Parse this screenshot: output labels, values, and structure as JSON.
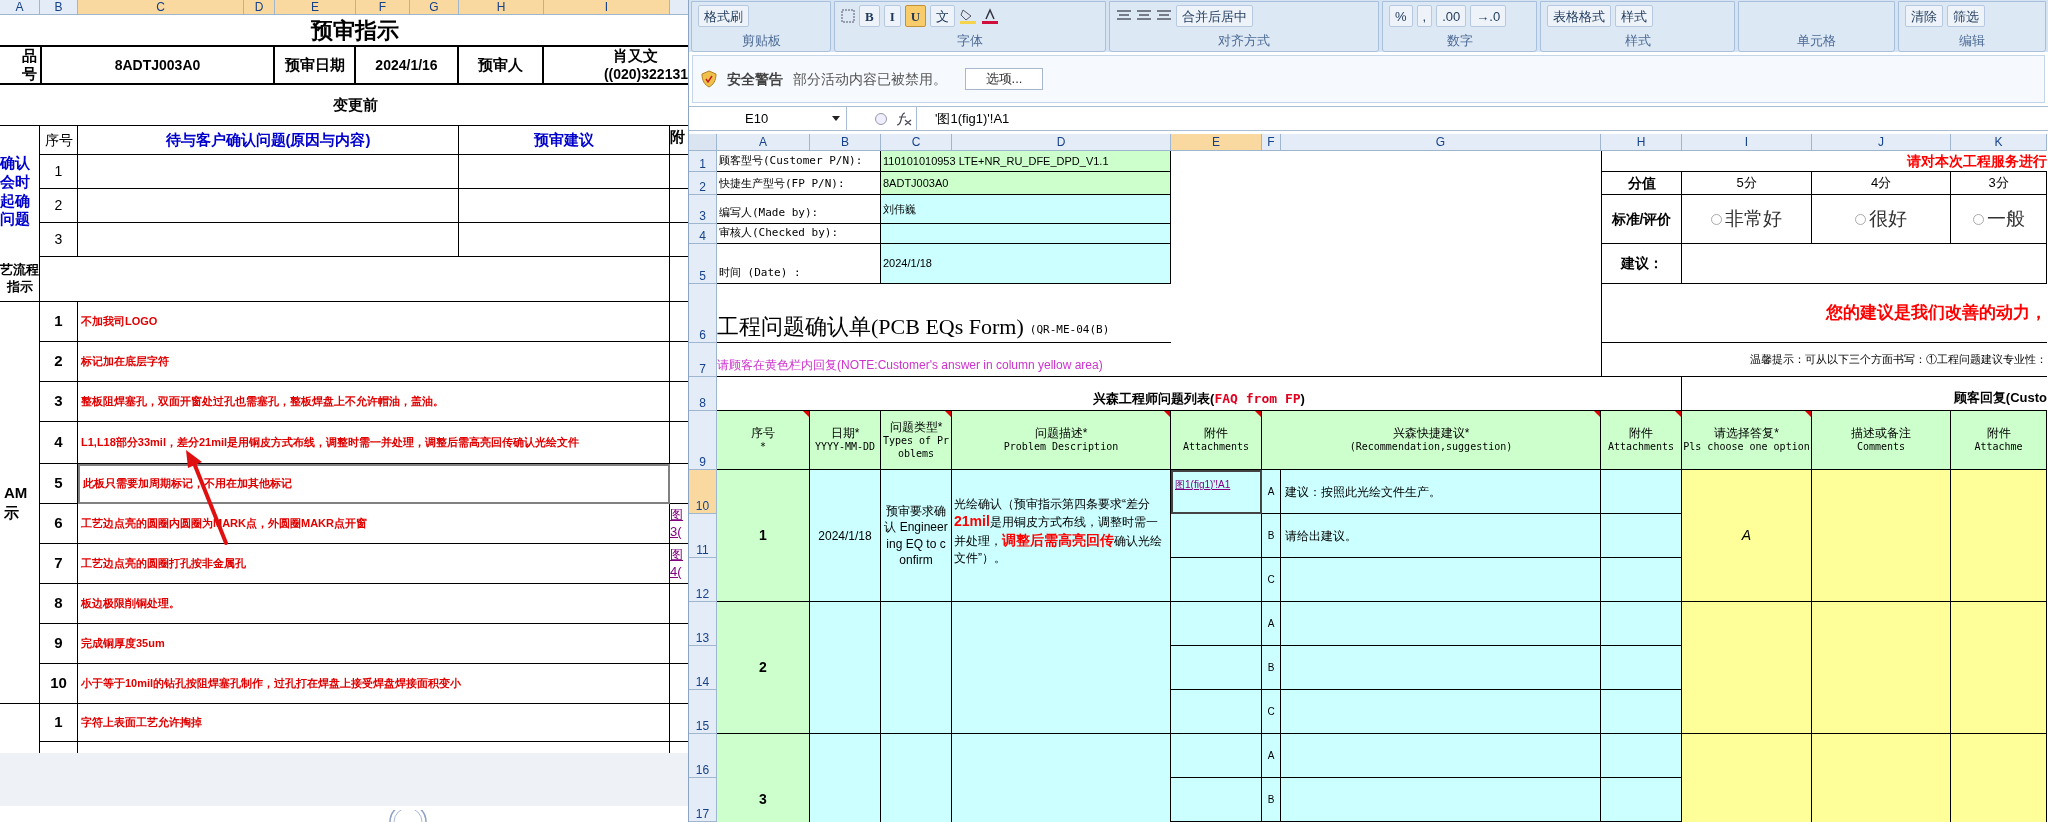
{
  "left_sheet": {
    "columns": [
      {
        "label": "A",
        "selected": false
      },
      {
        "label": "B",
        "selected": false
      },
      {
        "label": "C",
        "selected": true
      },
      {
        "label": "D",
        "selected": true
      },
      {
        "label": "E",
        "selected": true
      },
      {
        "label": "F",
        "selected": true
      },
      {
        "label": "G",
        "selected": true
      },
      {
        "label": "H",
        "selected": true
      },
      {
        "label": "I",
        "selected": true
      }
    ],
    "title": "预审指示",
    "product_label": "品号",
    "part_no": "8ADTJ003A0",
    "date_label": "预审日期",
    "date": "2024/1/16",
    "reviewer_label": "预审人",
    "reviewer": "肖又文",
    "phone": "((020)322131",
    "section": "变更前",
    "confirm": {
      "side_label": "确认会时起确问题",
      "no_header": "序号",
      "issue_header": "待与客户确认问题(原因与内容)",
      "advice_header": "预审建议",
      "attach_header": "附",
      "rows": [
        "1",
        "2",
        "3"
      ]
    },
    "process_label": [
      "艺流程",
      "指示"
    ],
    "cam_label": [
      "AM",
      "示"
    ],
    "cam_items": [
      {
        "no": "1",
        "text": "不加我司LOGO",
        "selected": false
      },
      {
        "no": "2",
        "text": "标记加在底层字符",
        "selected": false
      },
      {
        "no": "3",
        "text": "整板阻焊塞孔，双面开窗处过孔也需塞孔，整板焊盘上不允许帽油，盖油。",
        "selected": false
      },
      {
        "no": "4",
        "text": "L1,L18部分33mil，差分21mil是用铜皮方式布线，调整时需一并处理，调整后需高亮回传确认光绘文件",
        "selected": false
      },
      {
        "no": "5",
        "text": "此板只需要加周期标记，不用在加其他标记",
        "selected": true
      },
      {
        "no": "6",
        "text": "工艺边点亮的圆圈内圆圈为MARK点，外圆圈MAKR点开窗",
        "selected": false,
        "attachment": "图3("
      },
      {
        "no": "7",
        "text": "工艺边点亮的圆圈打孔按非金属孔",
        "selected": false,
        "attachment": "图4("
      },
      {
        "no": "8",
        "text": "板边极限削铜处理。",
        "selected": false
      },
      {
        "no": "9",
        "text": "完成铜厚度35um",
        "selected": false
      },
      {
        "no": "10",
        "text": "小于等于10mil的钻孔按阻焊塞孔制作，过孔打在焊盘上接受焊盘焊接面积变小",
        "selected": false
      }
    ],
    "next_items": [
      {
        "no": "1",
        "text": "字符上表面工艺允许掏掉",
        "selected": false
      }
    ]
  },
  "excel": {
    "ribbon": [
      {
        "label": "剪贴板",
        "controls": [
          {
            "label": "格式刷",
            "selected": false
          }
        ]
      },
      {
        "label": "字体",
        "controls": [
          {
            "label": "B",
            "selected": false
          },
          {
            "label": "I",
            "selected": false
          },
          {
            "label": "U",
            "selected": true
          },
          {
            "label": "文",
            "selected": false
          }
        ]
      },
      {
        "label": "对齐方式",
        "controls": [
          {
            "label": "合并后居中",
            "selected": false
          }
        ]
      },
      {
        "label": "数字",
        "controls": [
          {
            "label": "%",
            "selected": false
          },
          {
            "label": ",",
            "selected": false
          },
          {
            "label": ".00",
            "selected": false
          },
          {
            "label": "→.0",
            "selected": false
          }
        ]
      },
      {
        "label": "样式",
        "controls": [
          {
            "label": "表格格式",
            "selected": false
          },
          {
            "label": "样式",
            "selected": false
          }
        ]
      },
      {
        "label": "单元格"
      },
      {
        "label": "编辑",
        "controls": [
          {
            "label": "清除",
            "selected": false
          },
          {
            "label": "筛选",
            "selected": false
          }
        ]
      }
    ],
    "security": {
      "title": "安全警告",
      "message": "部分活动内容已被禁用。",
      "button": "选项..."
    },
    "formula_bar": {
      "name_box": "E10",
      "formula": "'图1(fig1)'!A1"
    },
    "columns": [
      {
        "label": "A",
        "selected": false
      },
      {
        "label": "B",
        "selected": false
      },
      {
        "label": "C",
        "selected": false
      },
      {
        "label": "D",
        "selected": false
      },
      {
        "label": "E",
        "selected": true
      },
      {
        "label": "F",
        "selected": false
      },
      {
        "label": "G",
        "selected": false
      },
      {
        "label": "H",
        "selected": false
      },
      {
        "label": "I",
        "selected": false
      },
      {
        "label": "J",
        "selected": false
      },
      {
        "label": "K",
        "selected": false
      }
    ],
    "rows": [
      {
        "label": "1",
        "selected": false
      },
      {
        "label": "2",
        "selected": false
      },
      {
        "label": "3",
        "selected": false
      },
      {
        "label": "4",
        "selected": false
      },
      {
        "label": "5",
        "selected": false
      },
      {
        "label": "6",
        "selected": false
      },
      {
        "label": "7",
        "selected": false
      },
      {
        "label": "8",
        "selected": false
      },
      {
        "label": "9",
        "selected": false
      },
      {
        "label": "10",
        "selected": true
      },
      {
        "label": "11",
        "selected": false
      },
      {
        "label": "12",
        "selected": false
      },
      {
        "label": "13",
        "selected": false
      },
      {
        "label": "14",
        "selected": false
      },
      {
        "label": "15",
        "selected": false
      },
      {
        "label": "16",
        "selected": false
      },
      {
        "label": "17",
        "selected": false
      }
    ],
    "info": [
      {
        "label": "顾客型号(Customer P/N):",
        "value": "110101010953 LTE+NR_RU_DFE_DPD_V1.1"
      },
      {
        "label": "快捷生产型号(FP P/N):",
        "value": "8ADTJ003A0"
      },
      {
        "label": "编写人(Made by):",
        "value": "刘伟巍"
      },
      {
        "label": "审核人(Checked by):"
      },
      {
        "label": "时间 (Date) :",
        "value": "2024/1/18"
      }
    ],
    "form_title": "工程问题确认单(PCB EQs Form)",
    "form_code": "(QR-ME-04(B)",
    "note": "请顾客在黄色栏内回复(NOTE:Customer's answer in column yellow area)",
    "rating": {
      "prompt": "请对本次工程服务进行",
      "score_label": "分值",
      "scores": [
        "5分",
        "4分",
        "3分"
      ],
      "criteria_label": "标准/评价",
      "options": [
        {
          "label": "非常好",
          "selected": false
        },
        {
          "label": "很好",
          "selected": false
        },
        {
          "label": "一般",
          "selected": false
        }
      ],
      "suggest_label": "建议：",
      "motto": "您的建议是我们改善的动力，",
      "tip": "温馨提示：可从以下三个方面书写：①工程问题建议专业性："
    },
    "faq_title": "兴森工程师问题列表(**FAQ from FP**)",
    "reply_title": "顾客回复(Custo",
    "headers": [
      {
        "cn": "序号",
        "en": "*",
        "comment": true
      },
      {
        "cn": "日期*",
        "en": "YYYY-MM-DD",
        "comment": false
      },
      {
        "cn": "问题类型*",
        "en": "Types of Problems",
        "comment": true
      },
      {
        "cn": "问题描述*",
        "en": "Problem Description",
        "comment": true
      },
      {
        "cn": "附件",
        "en": "Attachments",
        "comment": true
      },
      {
        "cn": "兴森快捷建议*",
        "en": "(Recommendation,suggestion)",
        "comment": true
      },
      {
        "cn": "附件",
        "en": "Attachments",
        "comment": true
      },
      {
        "cn": "请选择答复*",
        "en": "Pls choose one option",
        "comment": true
      },
      {
        "cn": "描述或备注",
        "en": "Comments",
        "comment": false
      },
      {
        "cn": "附件",
        "en": "Attachme",
        "comment": false
      }
    ],
    "questions": [
      {
        "no": "1",
        "date": "2024/1/18",
        "type": "预审要求确认 Engineering EQ to confirm",
        "description": "光绘确认（预审指示第四条要求“差分**21mil**是用铜皮方式布线，调整时需一并处理，**调整后需高亮回传**确认光绘文件”）。",
        "answer": "A",
        "options": [
          {
            "letter": "A",
            "attachment": "图1(fig1)'!A1",
            "suggestion": "建议：按照此光绘文件生产。",
            "selected": true
          },
          {
            "letter": "B",
            "suggestion": "请给出建议。",
            "selected": false
          },
          {
            "letter": "C",
            "selected": false
          }
        ]
      },
      {
        "no": "2",
        "options": [
          {
            "letter": "A",
            "selected": false
          },
          {
            "letter": "B",
            "selected": false
          },
          {
            "letter": "C",
            "selected": false
          }
        ]
      },
      {
        "no": "3",
        "options": [
          {
            "letter": "A",
            "selected": false
          },
          {
            "letter": "B",
            "selected": false
          }
        ]
      }
    ]
  }
}
